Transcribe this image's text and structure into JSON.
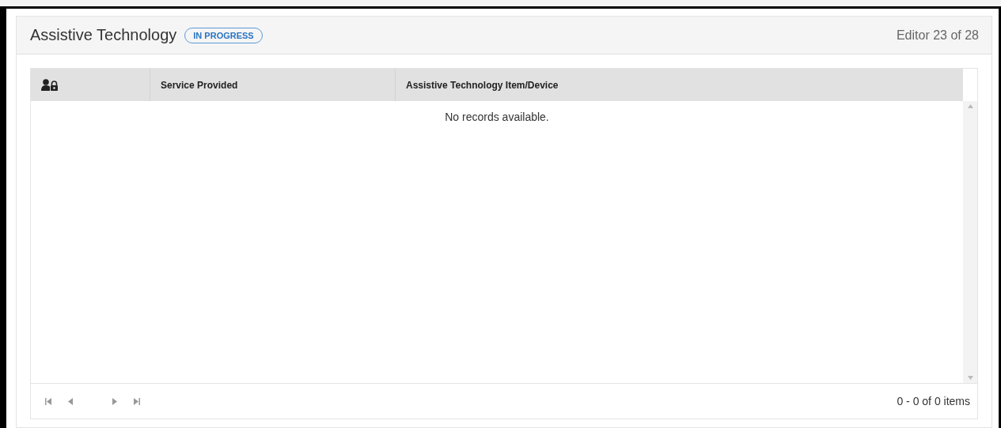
{
  "panel": {
    "title": "Assistive Technology",
    "status_badge": "IN PROGRESS",
    "editor_count": "Editor 23 of 28"
  },
  "grid": {
    "columns": [
      {
        "kind": "icon"
      },
      {
        "kind": "text",
        "label": "Service Provided"
      },
      {
        "kind": "text",
        "label": "Assistive Technology Item/Device"
      }
    ],
    "empty_message": "No records available.",
    "pager": {
      "disabled": true,
      "summary": "0 - 0 of 0 items"
    }
  }
}
